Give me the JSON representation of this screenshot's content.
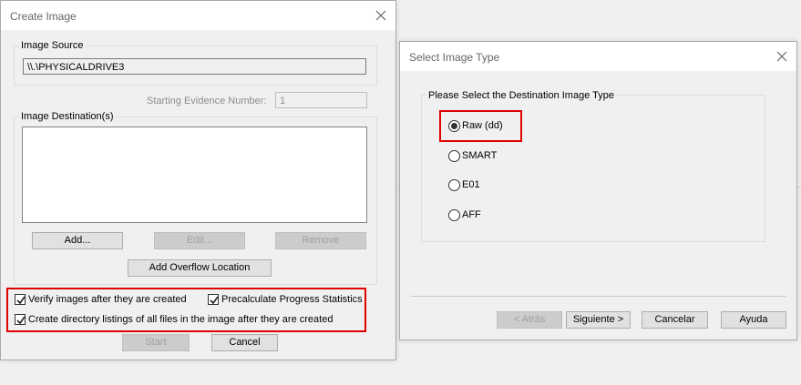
{
  "create_image": {
    "title": "Create Image",
    "image_source_label": "Image Source",
    "image_source_value": "\\\\.\\PHYSICALDRIVE3",
    "starting_evidence_label": "Starting Evidence Number:",
    "starting_evidence_value": "1",
    "image_destination_label": "Image Destination(s)",
    "add_label": "Add...",
    "edit_label": "Edit...",
    "remove_label": "Remove",
    "add_overflow_label": "Add Overflow Location",
    "verify_label": "Verify images after they are created",
    "precalc_label": "Precalculate Progress Statistics",
    "directory_label": "Create directory listings of all files in the image after they are created",
    "start_label": "Start",
    "cancel_label": "Cancel"
  },
  "select_type": {
    "title": "Select Image Type",
    "group_label": "Please Select the Destination Image Type",
    "options": [
      {
        "label": "Raw (dd)",
        "selected": true
      },
      {
        "label": "SMART",
        "selected": false
      },
      {
        "label": "E01",
        "selected": false
      },
      {
        "label": "AFF",
        "selected": false
      }
    ],
    "back_label": "< Atrás",
    "next_label": "Siguiente >",
    "cancel_label": "Cancelar",
    "help_label": "Ayuda"
  },
  "colors": {
    "highlight": "#e00000",
    "window_bg": "#f0f0f0"
  }
}
